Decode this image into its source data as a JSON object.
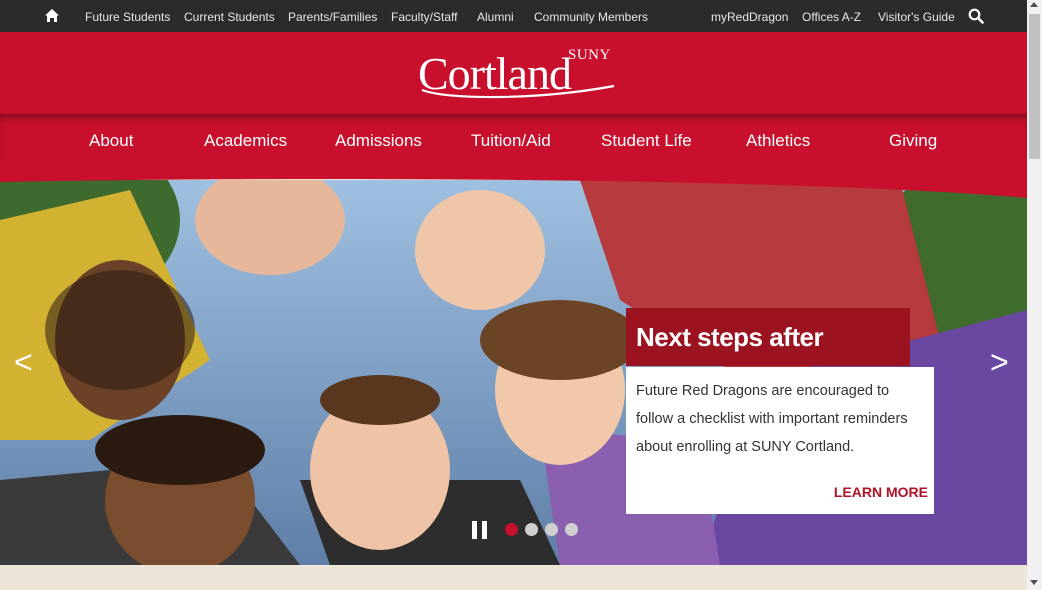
{
  "topbar": {
    "links": [
      "Future Students",
      "Current Students",
      "Parents/Families",
      "Faculty/Staff",
      "Alumni",
      "Community Members"
    ],
    "right_links": [
      "myRedDragon",
      "Offices A-Z",
      "Visitor's Guide"
    ],
    "home_icon": "home-icon",
    "search_icon": "search-icon"
  },
  "logo": {
    "suny": "SUNY",
    "name": "Cortland"
  },
  "nav": {
    "items": [
      "About",
      "Academics",
      "Admissions",
      "Tuition/Aid",
      "Student Life",
      "Athletics",
      "Giving"
    ]
  },
  "hero": {
    "prev": "<",
    "next": ">",
    "caption_title": "Next steps after acceptance",
    "caption_text": "Future Red Dragons are encouraged to follow a checklist with important reminders about enrolling at SUNY Cortland.",
    "cta": "LEARN MORE",
    "slide_count": 4,
    "active_slide": 1
  },
  "colors": {
    "brand_red": "#c8102e",
    "dark_red": "#9b1220",
    "topbar": "#2b2b2b"
  }
}
